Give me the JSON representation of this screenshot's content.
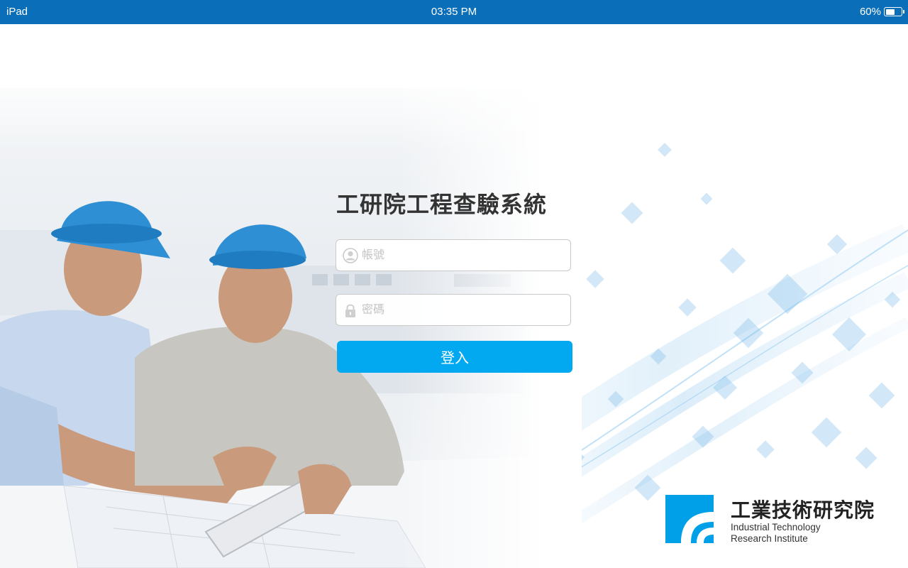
{
  "status_bar": {
    "device": "iPad",
    "time": "03:35 PM",
    "battery": "60%",
    "battery_level": 0.6
  },
  "login": {
    "title": "工研院工程查驗系統",
    "username_placeholder": "帳號",
    "password_placeholder": "密碼",
    "submit_label": "登入"
  },
  "logo": {
    "name_cn": "工業技術研究院",
    "name_en_line1": "Industrial Technology",
    "name_en_line2": "Research Institute"
  },
  "colors": {
    "status_bar": "#0a6fb8",
    "accent_button": "#03a9f0",
    "logo_blue": "#00a0e9"
  },
  "icons": [
    "battery-icon",
    "user-icon",
    "lock-icon",
    "itri-logo-mark"
  ]
}
